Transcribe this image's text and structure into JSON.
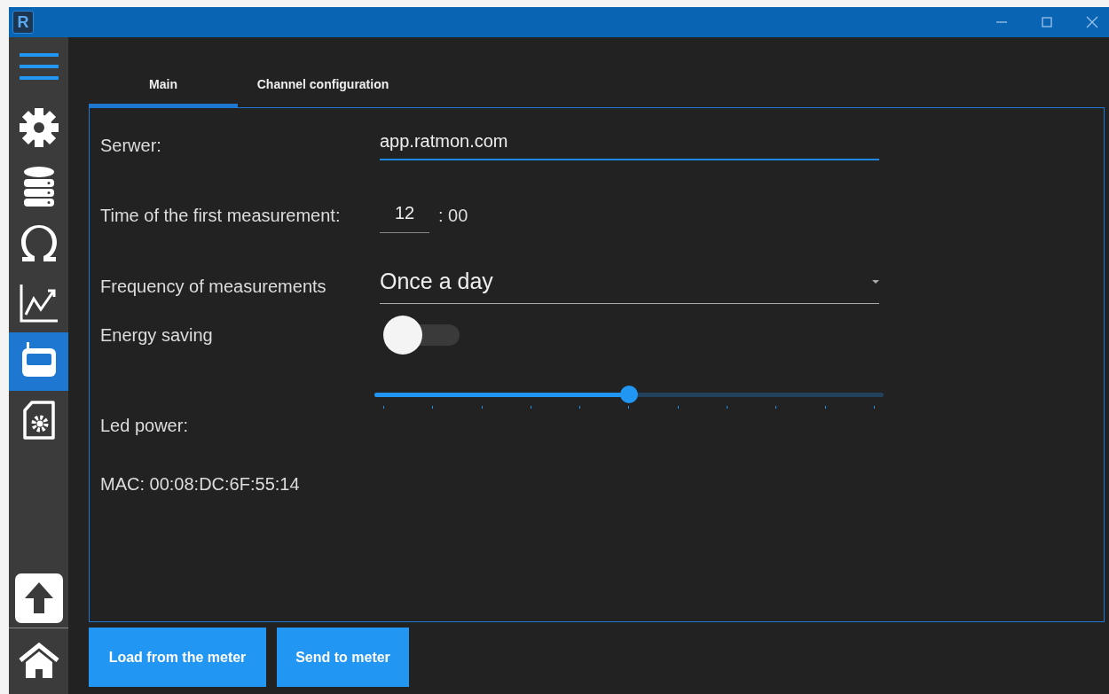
{
  "window": {
    "logo": "R"
  },
  "sidebar": {
    "items": [
      {
        "kind": "gear",
        "selected": false
      },
      {
        "kind": "database",
        "selected": false
      },
      {
        "kind": "omega",
        "selected": false
      },
      {
        "kind": "chart",
        "selected": false
      },
      {
        "kind": "meter",
        "selected": true
      },
      {
        "kind": "doc-gear",
        "selected": false
      }
    ],
    "bottom_items": [
      {
        "kind": "upload"
      },
      {
        "kind": "home"
      }
    ]
  },
  "tabs": [
    {
      "label": "Main",
      "selected": true
    },
    {
      "label": "Channel configuration",
      "selected": false
    }
  ],
  "form": {
    "server": {
      "label": "Serwer:",
      "value": "app.ratmon.com"
    },
    "time": {
      "label": "Time of the first measurement:",
      "hour": "12",
      "minutes": ": 00"
    },
    "frequency": {
      "label": "Frequency of measurements",
      "value": "Once a day"
    },
    "energy_saving": {
      "label": "Energy saving",
      "on": false
    },
    "led_power": {
      "label": "Led power:",
      "level": 0.5
    },
    "mac": "MAC: 00:08:DC:6F:55:14"
  },
  "buttons": [
    "Load from the meter",
    "Send to meter"
  ]
}
